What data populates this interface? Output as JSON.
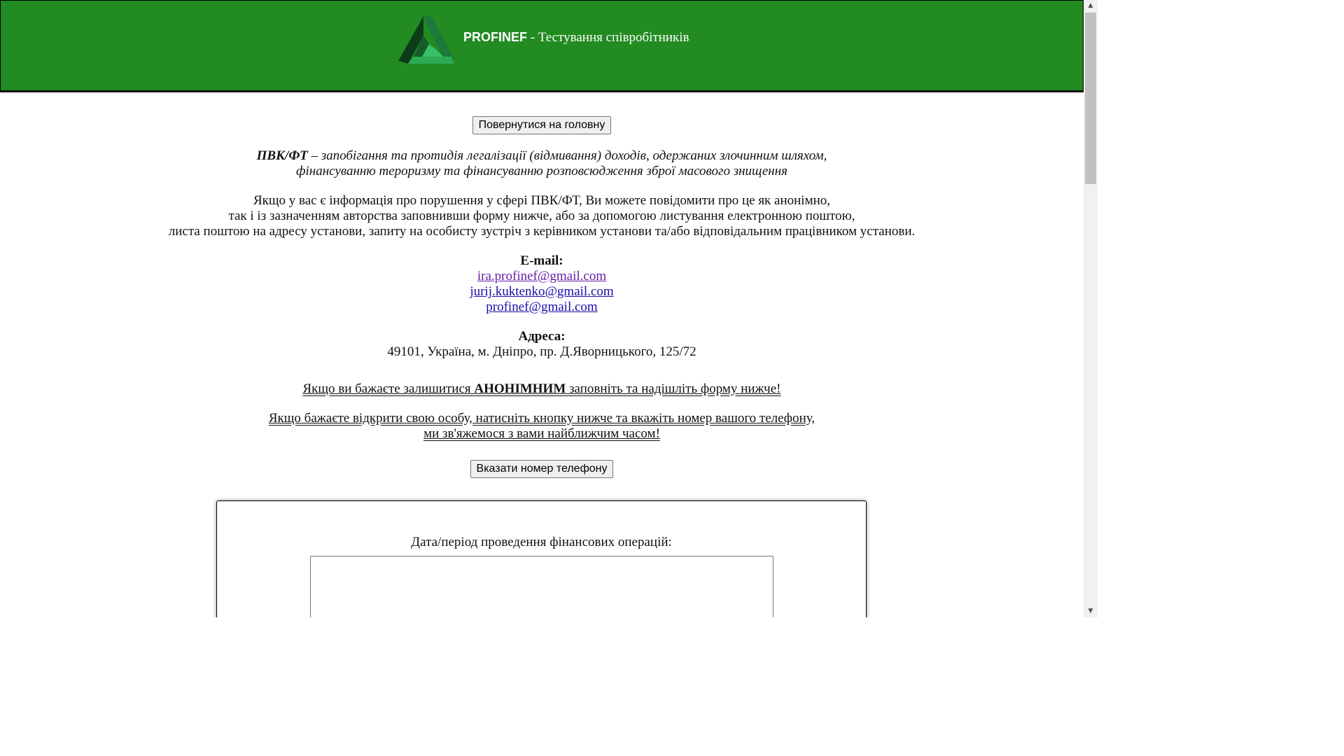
{
  "header": {
    "brand_name": "PROFINEF",
    "brand_subtitle": " - Тестування співробітників",
    "logo_icon": "triangle-logo-icon",
    "bg_color": "#228b22"
  },
  "buttons": {
    "home": "Повернутися на головну",
    "phone": "Вказати номер телефону"
  },
  "definition": {
    "term": "ПВК/ФТ",
    "line1": " – запобігання та протидія легалізації (відмивання) доходів, одержаних злочинним шляхом,",
    "line2": "фінансуванню тероризму та фінансуванню розповсюдження зброї масового знищення"
  },
  "info": {
    "line1": "Якщо у вас є інформація про порушення у сфері ПВК/ФТ, Ви можете повідомити про це як анонімно,",
    "line2": "так і із зазначенням авторства заповнивши форму нижче, або за допомогою листування електронною поштою,",
    "line3": "листа поштою на адресу установи, запиту на особисту зустріч з керівником установи та/або відповідальним працівником установи."
  },
  "contacts": {
    "email_label": "E-mail:",
    "emails": [
      "ira.profinef@gmail.com",
      "jurij.kuktenko@gmail.com",
      "profinef@gmail.com"
    ],
    "address_label": "Адреса:",
    "address": "49101, Україна, м. Дніпро, пр. Д.Яворницького, 125/72"
  },
  "anon": {
    "before": "Якщо ви бажаєте залишитися ",
    "bold": "АНОНІМНИМ",
    "after": " заповніть та надішліть форму нижче!"
  },
  "reveal": {
    "line1": "Якщо бажаєте відкрити свою особу, натисніть кнопку нижче та вкажіть номер вашого телефону,",
    "line2": "ми зв'яжемося з вами найближчим часом!"
  },
  "form": {
    "field_label": "Дата/період проведення фінансових операцій:",
    "field_value": ""
  }
}
